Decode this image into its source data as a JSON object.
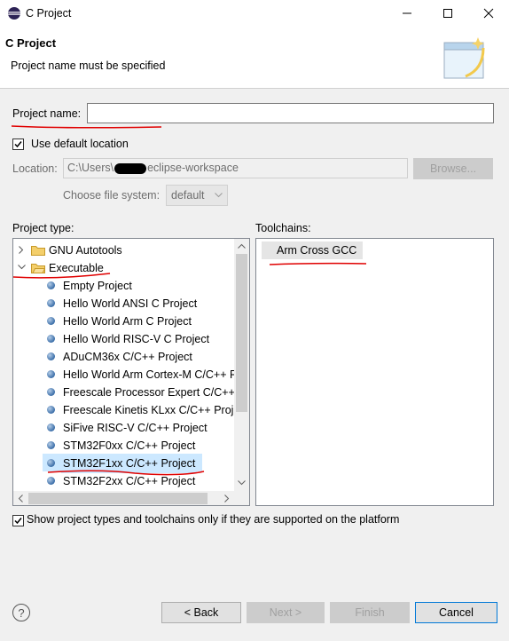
{
  "window": {
    "title": "C Project"
  },
  "banner": {
    "title": "C Project",
    "message": "Project name must be specified"
  },
  "form": {
    "project_name_label": "Project name:",
    "project_name_value": "",
    "use_default_location_label": "Use default location",
    "use_default_location_checked": true,
    "location_label": "Location:",
    "location_value_prefix": "C:\\Users\\",
    "location_value_suffix": "eclipse-workspace",
    "browse_label": "Browse...",
    "file_system_label": "Choose file system:",
    "file_system_value": "default"
  },
  "project_type": {
    "label": "Project type:",
    "items": [
      {
        "label": "GNU Autotools",
        "kind": "folder",
        "expanded": false
      },
      {
        "label": "Executable",
        "kind": "folder",
        "expanded": true
      },
      {
        "label": "Empty Project",
        "kind": "leaf"
      },
      {
        "label": "Hello World ANSI C Project",
        "kind": "leaf"
      },
      {
        "label": "Hello World Arm C Project",
        "kind": "leaf"
      },
      {
        "label": "Hello World RISC-V C Project",
        "kind": "leaf"
      },
      {
        "label": "ADuCM36x C/C++ Project",
        "kind": "leaf"
      },
      {
        "label": "Hello World Arm Cortex-M C/C++ Project",
        "kind": "leaf"
      },
      {
        "label": "Freescale Processor Expert C/C++ Project",
        "kind": "leaf"
      },
      {
        "label": "Freescale Kinetis KLxx C/C++ Project",
        "kind": "leaf"
      },
      {
        "label": "SiFive RISC-V C/C++ Project",
        "kind": "leaf"
      },
      {
        "label": "STM32F0xx C/C++ Project",
        "kind": "leaf"
      },
      {
        "label": "STM32F1xx C/C++ Project",
        "kind": "leaf",
        "selected": true
      },
      {
        "label": "STM32F2xx C/C++ Project",
        "kind": "leaf"
      }
    ]
  },
  "toolchains": {
    "label": "Toolchains:",
    "items": [
      {
        "label": "Arm Cross GCC"
      }
    ]
  },
  "filter": {
    "label": "Show project types and toolchains only if they are supported on the platform",
    "checked": true
  },
  "buttons": {
    "back": "< Back",
    "next": "Next >",
    "finish": "Finish",
    "cancel": "Cancel"
  },
  "colors": {
    "annotation_red": "#e00000",
    "selection": "#cce8ff",
    "primary_border": "#0078d7"
  }
}
